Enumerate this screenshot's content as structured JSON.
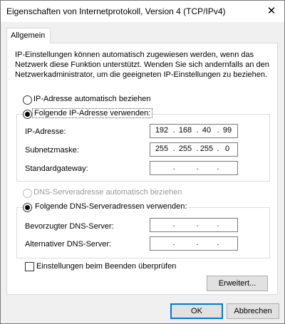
{
  "window": {
    "title": "Eigenschaften von Internetprotokoll, Version 4 (TCP/IPv4)",
    "close_glyph": "✕"
  },
  "tab": {
    "label": "Allgemein"
  },
  "intro_text": "IP-Einstellungen können automatisch zugewiesen werden, wenn das Netzwerk diese Funktion unterstützt. Wenden Sie sich andernfalls an den Netzwerkadministrator, um die geeigneten IP-Einstellungen zu beziehen.",
  "ip": {
    "auto_radio_label": "IP-Adresse automatisch beziehen",
    "manual_radio_label": "Folgende IP-Adresse verwenden:",
    "selected": "manual",
    "fields": [
      {
        "label": "IP-Adresse:",
        "octets": [
          "192",
          "168",
          "40",
          "99"
        ]
      },
      {
        "label": "Subnetzmaske:",
        "octets": [
          "255",
          "255",
          "255",
          "0"
        ]
      },
      {
        "label": "Standardgateway:",
        "octets": [
          "",
          "",
          "",
          ""
        ]
      }
    ]
  },
  "dns": {
    "auto_radio_label": "DNS-Serveradresse automatisch beziehen",
    "manual_radio_label": "Folgende DNS-Serveradressen verwenden:",
    "selected": "manual",
    "auto_disabled": true,
    "fields": [
      {
        "label": "Bevorzugter DNS-Server:",
        "octets": [
          "",
          "",
          "",
          ""
        ]
      },
      {
        "label": "Alternativer DNS-Server:",
        "octets": [
          "",
          "",
          "",
          ""
        ]
      }
    ]
  },
  "validate_checkbox": {
    "label": "Einstellungen beim Beenden überprüfen",
    "checked": false
  },
  "buttons": {
    "advanced": "Erweitert...",
    "ok": "OK",
    "cancel": "Abbrechen"
  },
  "colors": {
    "window_bg": "#f0f0f0",
    "panel_bg": "#ffffff",
    "focus_border": "#0078d7",
    "disabled_text": "#9a9a9a"
  }
}
